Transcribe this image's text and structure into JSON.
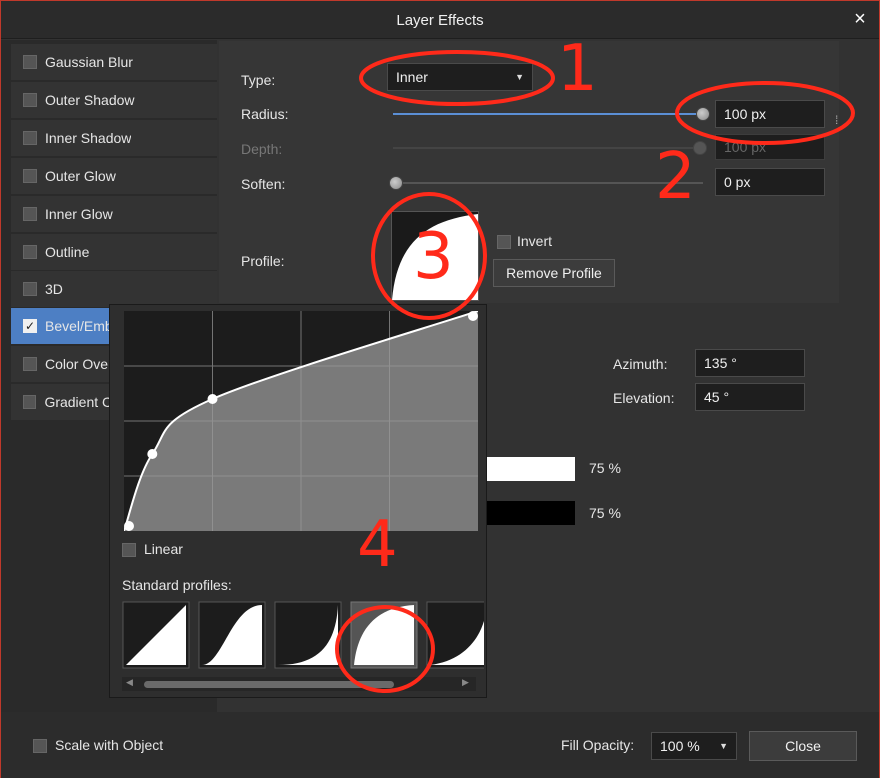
{
  "window": {
    "title": "Layer Effects",
    "close_symbol": "×"
  },
  "sidebar": {
    "items": [
      {
        "label": "Gaussian Blur",
        "checked": false
      },
      {
        "label": "Outer Shadow",
        "checked": false
      },
      {
        "label": "Inner Shadow",
        "checked": false
      },
      {
        "label": "Outer Glow",
        "checked": false
      },
      {
        "label": "Inner Glow",
        "checked": false
      },
      {
        "label": "Outline",
        "checked": false
      },
      {
        "label": "3D",
        "checked": false
      },
      {
        "label": "Bevel/Emb",
        "checked": true,
        "check_mark": "✓"
      },
      {
        "label": "Color Ove",
        "checked": false
      },
      {
        "label": "Gradient C",
        "checked": false
      }
    ]
  },
  "settings": {
    "type_label": "Type:",
    "type_value": "Inner",
    "radius_label": "Radius:",
    "radius_value": "100 px",
    "radius_fraction": 1.0,
    "depth_label": "Depth:",
    "depth_value": "100 px",
    "soften_label": "Soften:",
    "soften_value": "0 px",
    "soften_fraction": 0.0,
    "profile_label": "Profile:",
    "invert_label": "Invert",
    "remove_profile_label": "Remove Profile",
    "azimuth_label": "Azimuth:",
    "azimuth_value": "135 °",
    "elevation_label": "Elevation:",
    "elevation_value": "45 °",
    "highlight_opacity": "75 %",
    "shadow_opacity": "75 %",
    "highlight_color": "#ffffff",
    "shadow_color": "#000000"
  },
  "profile_popup": {
    "linear_label": "Linear",
    "standard_profiles_label": "Standard profiles:",
    "curve_points": [
      [
        0,
        0
      ],
      [
        0.08,
        0.35
      ],
      [
        0.25,
        0.6
      ],
      [
        1.0,
        1.0
      ]
    ],
    "profiles": [
      "linear-profile",
      "s-curve-profile",
      "concave-profile",
      "convex-profile",
      "steep-profile"
    ],
    "selected_profile": 3
  },
  "annotations": [
    "1",
    "2",
    "3",
    "4"
  ],
  "annotation_color": "#ff2a1a",
  "footer": {
    "scale_label": "Scale with Object",
    "fill_opacity_label": "Fill Opacity:",
    "fill_opacity_value": "100 %",
    "close_label": "Close"
  },
  "accent_color": "#4d7fc4"
}
